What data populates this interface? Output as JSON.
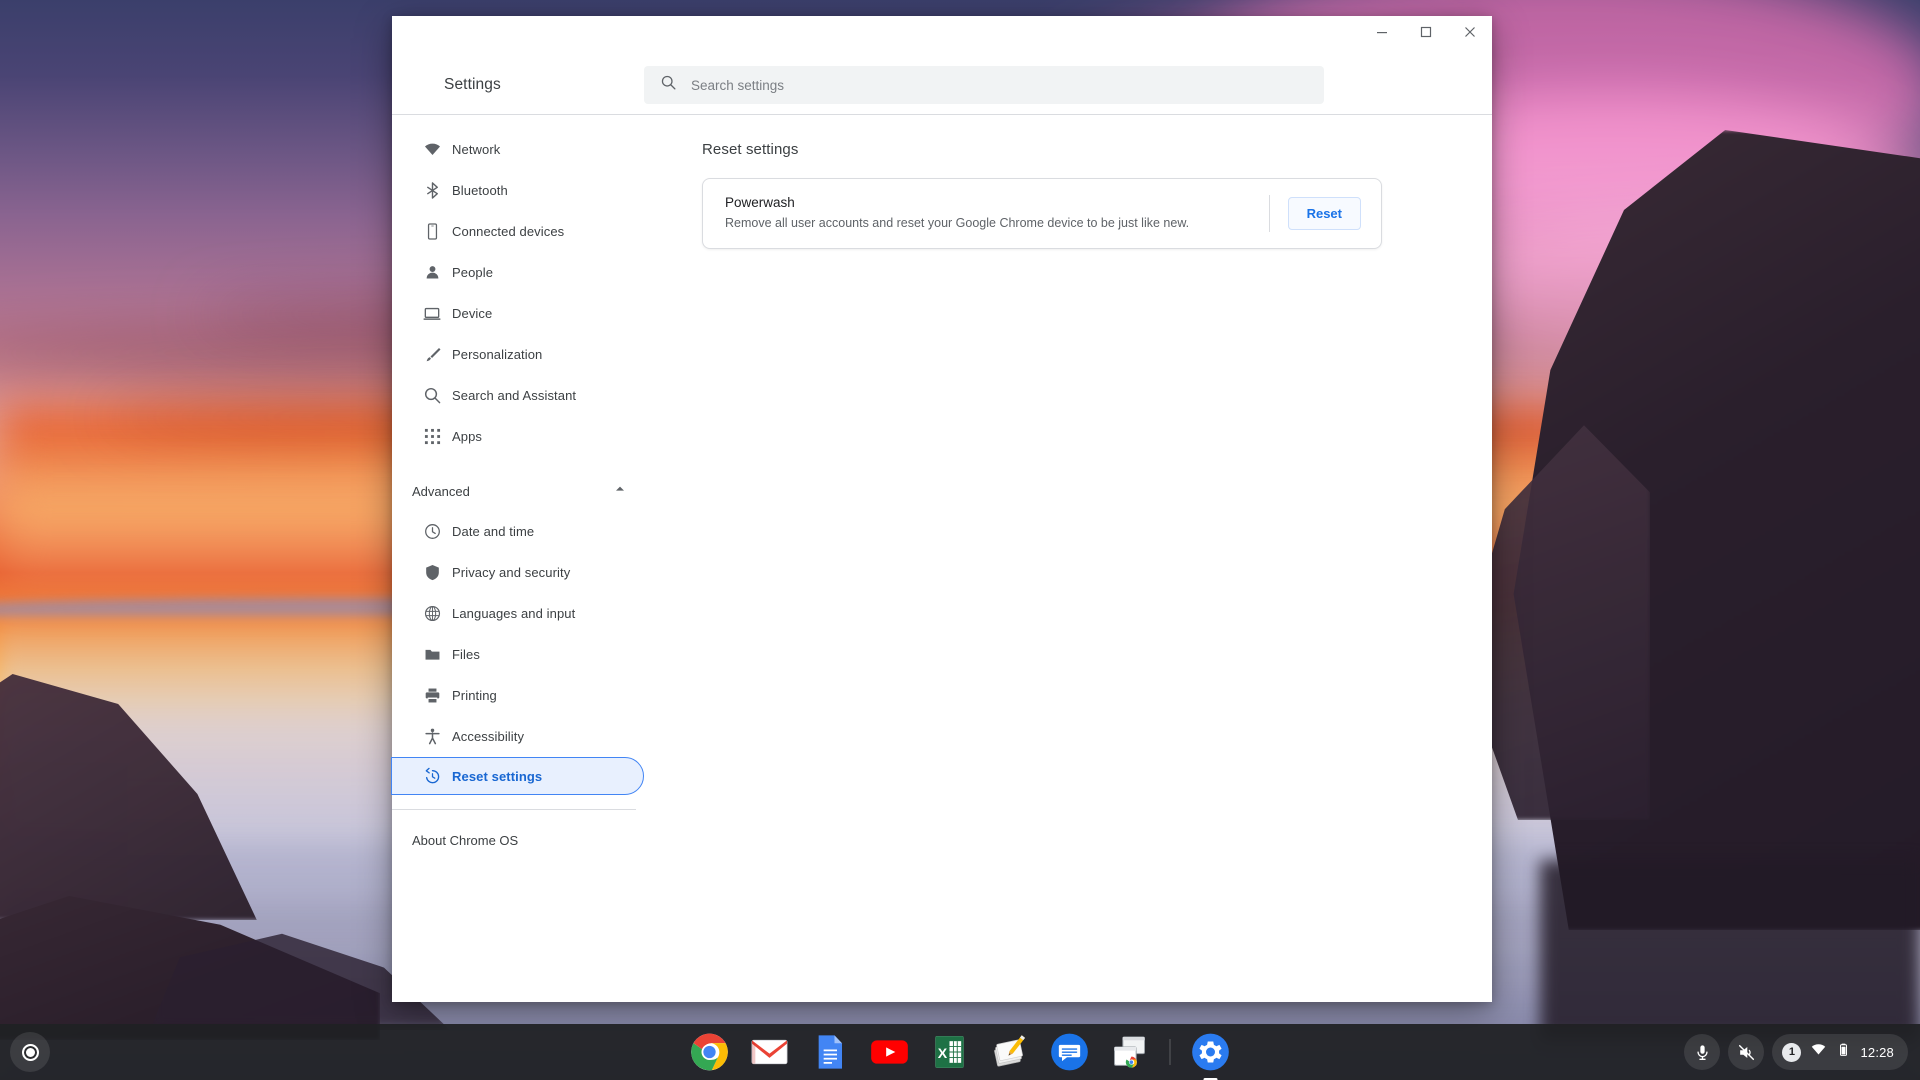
{
  "wallpaper": {
    "description": "sunset seascape with cliffs"
  },
  "window": {
    "title": "Settings",
    "controls": {
      "minimize": "minimize-button",
      "maximize": "maximize-button",
      "close": "close-button"
    }
  },
  "search": {
    "placeholder": "Search settings",
    "value": "",
    "icon": "search-icon"
  },
  "sidebar": {
    "items": [
      {
        "label": "Network",
        "icon": "wifi-icon",
        "selected": false
      },
      {
        "label": "Bluetooth",
        "icon": "bluetooth-icon",
        "selected": false
      },
      {
        "label": "Connected devices",
        "icon": "phone-icon",
        "selected": false
      },
      {
        "label": "People",
        "icon": "person-icon",
        "selected": false
      },
      {
        "label": "Device",
        "icon": "laptop-icon",
        "selected": false
      },
      {
        "label": "Personalization",
        "icon": "brush-icon",
        "selected": false
      },
      {
        "label": "Search and Assistant",
        "icon": "search-icon",
        "selected": false
      },
      {
        "label": "Apps",
        "icon": "apps-grid-icon",
        "selected": false
      }
    ],
    "advanced": {
      "label": "Advanced",
      "expanded": true,
      "chevron_icon": "chevron-up-icon",
      "items": [
        {
          "label": "Date and time",
          "icon": "clock-icon",
          "selected": false
        },
        {
          "label": "Privacy and security",
          "icon": "shield-icon",
          "selected": false
        },
        {
          "label": "Languages and input",
          "icon": "globe-icon",
          "selected": false
        },
        {
          "label": "Files",
          "icon": "folder-icon",
          "selected": false
        },
        {
          "label": "Printing",
          "icon": "printer-icon",
          "selected": false
        },
        {
          "label": "Accessibility",
          "icon": "accessibility-icon",
          "selected": false
        },
        {
          "label": "Reset settings",
          "icon": "history-icon",
          "selected": true
        }
      ]
    },
    "about": {
      "label": "About Chrome OS"
    }
  },
  "main": {
    "heading": "Reset settings",
    "card": {
      "title": "Powerwash",
      "description": "Remove all user accounts and reset your Google Chrome device to be just like new.",
      "button_label": "Reset"
    }
  },
  "shelf": {
    "launcher": "launcher-button",
    "apps": [
      {
        "name": "Chrome",
        "icon": "chrome-icon",
        "active": false
      },
      {
        "name": "Gmail",
        "icon": "gmail-icon",
        "active": false
      },
      {
        "name": "Docs",
        "icon": "docs-icon",
        "active": false
      },
      {
        "name": "YouTube",
        "icon": "youtube-icon",
        "active": false
      },
      {
        "name": "Sheets",
        "icon": "sheets-icon",
        "active": false
      },
      {
        "name": "Keep",
        "icon": "keep-notes-icon",
        "active": false
      },
      {
        "name": "Messages",
        "icon": "messages-icon",
        "active": false
      },
      {
        "name": "Screen capture",
        "icon": "screen-capture-icon",
        "active": false
      },
      {
        "name": "Settings",
        "icon": "settings-gear-icon",
        "active": true
      }
    ],
    "tray": {
      "microphone_icon": "microphone-icon",
      "volume_icon": "volume-muted-icon",
      "notification_count": "1",
      "wifi_icon": "wifi-icon",
      "battery_icon": "battery-icon",
      "time": "12:28"
    }
  },
  "colors": {
    "accent_blue": "#1a73e8",
    "selected_bg": "#e8f0fe",
    "selected_border": "#4285f4",
    "text_primary": "#202124",
    "text_secondary": "#5f6368",
    "divider": "#dadce0",
    "shelf_bg": "#202124"
  }
}
